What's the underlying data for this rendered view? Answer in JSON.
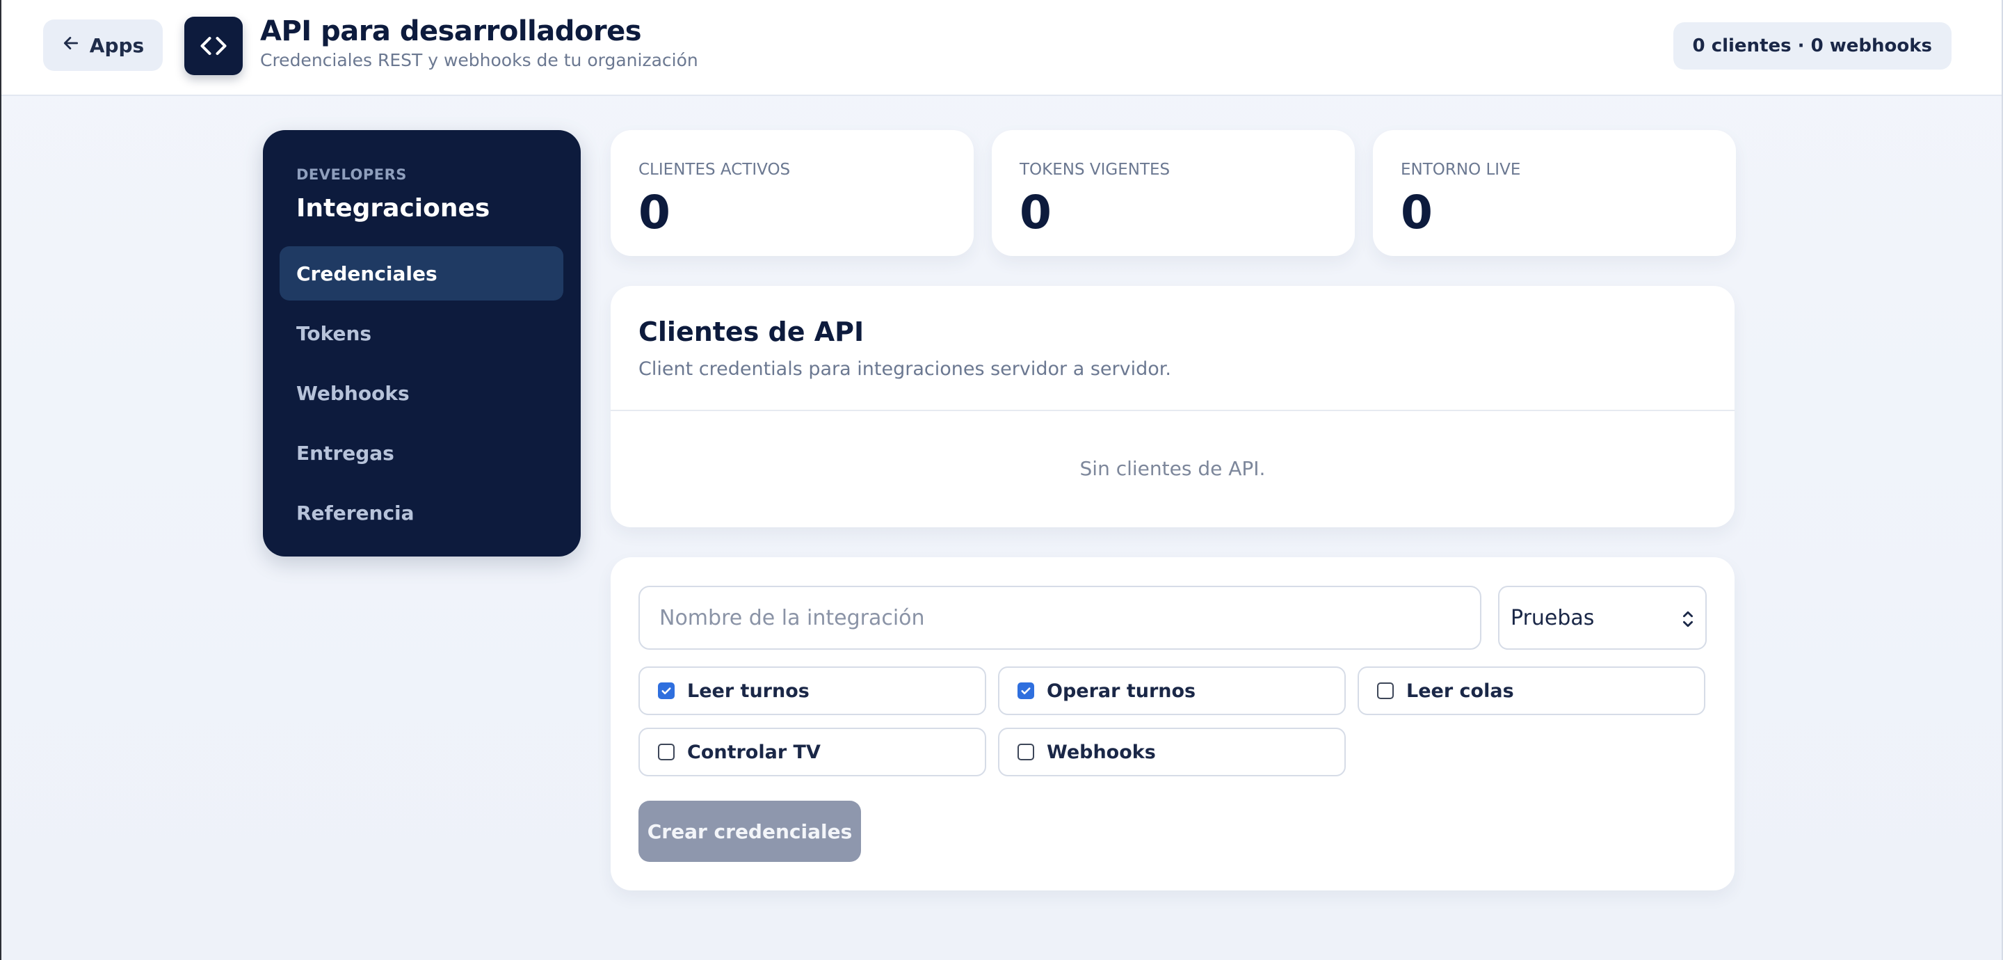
{
  "header": {
    "back_label": "Apps",
    "title": "API para desarrolladores",
    "subtitle": "Credenciales REST y webhooks de tu organización",
    "summary_badge": "0 clientes · 0 webhooks"
  },
  "sidebar": {
    "eyebrow": "DEVELOPERS",
    "title": "Integraciones",
    "active_item": "Credenciales",
    "items": [
      {
        "label": "Credenciales"
      },
      {
        "label": "Tokens"
      },
      {
        "label": "Webhooks"
      },
      {
        "label": "Entregas"
      },
      {
        "label": "Referencia"
      }
    ]
  },
  "stats": [
    {
      "label": "CLIENTES ACTIVOS",
      "value": "0"
    },
    {
      "label": "TOKENS VIGENTES",
      "value": "0"
    },
    {
      "label": "ENTORNO LIVE",
      "value": "0"
    }
  ],
  "clients": {
    "title": "Clientes de API",
    "subtitle": "Client credentials para integraciones servidor a servidor.",
    "empty_text": "Sin clientes de API."
  },
  "form": {
    "name_placeholder": "Nombre de la integración",
    "name_value": "",
    "environment_selected": "Pruebas",
    "scopes": [
      {
        "label": "Leer turnos",
        "checked": true
      },
      {
        "label": "Operar turnos",
        "checked": true
      },
      {
        "label": "Leer colas",
        "checked": false
      },
      {
        "label": "Controlar TV",
        "checked": false
      },
      {
        "label": "Webhooks",
        "checked": false
      }
    ],
    "submit_label": "Crear credenciales"
  },
  "colors": {
    "navy": "#0d1b3d",
    "active_nav": "#1f3a63",
    "checkbox_checked": "#2f6fde",
    "button_disabled": "#8e97ad",
    "page_bg": "#eef2f9"
  },
  "icons": {
    "back": "arrow-left-icon",
    "logo": "code-brackets-icon",
    "select": "chevron-up-down-icon",
    "checked": "check-icon"
  }
}
